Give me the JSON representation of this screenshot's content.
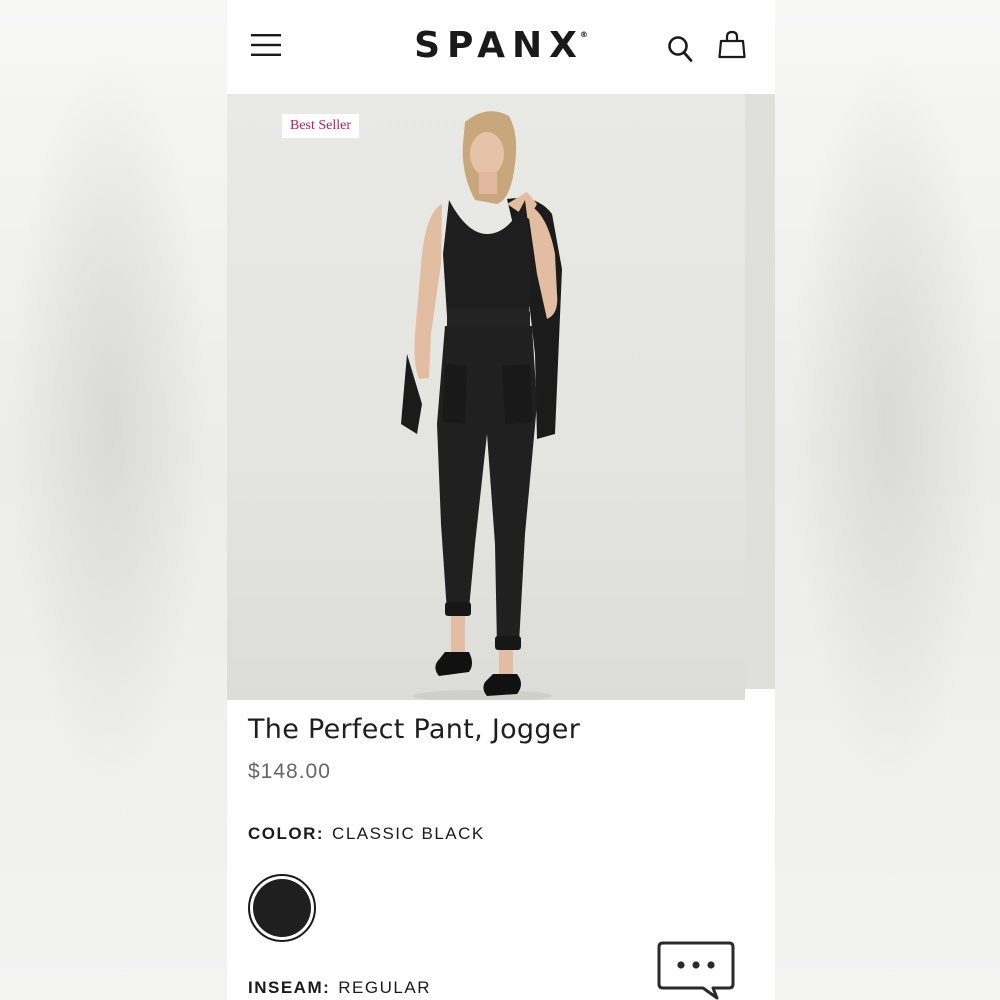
{
  "header": {
    "brand": "SPANX",
    "brand_mark": "®",
    "icons": [
      "menu-icon",
      "search-icon",
      "shopping-bag-icon"
    ]
  },
  "hero": {
    "badge": "Best Seller",
    "image_alt_icon": "model-photo"
  },
  "product": {
    "title": "The Perfect Pant, Jogger",
    "price": "$148.00",
    "color_label": "COLOR:",
    "color_value": "CLASSIC BLACK",
    "swatch_color": "#1f1f1f",
    "inseam_label": "INSEAM:",
    "inseam_value": "REGULAR"
  },
  "chat": {
    "icon": "chat-bubble-icon"
  },
  "colors": {
    "badge_text": "#c2185b",
    "text_primary": "#1a1a1a",
    "price_text": "#666666"
  }
}
